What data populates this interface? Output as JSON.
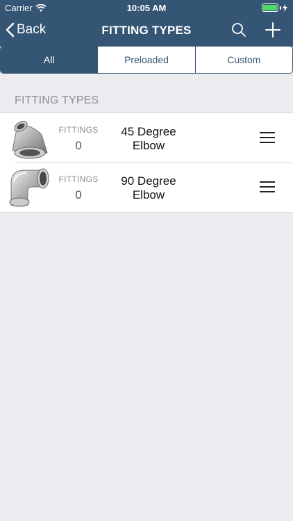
{
  "status_bar": {
    "carrier": "Carrier",
    "time": "10:05 AM",
    "battery_color": "#4cd964"
  },
  "nav": {
    "back_label": "Back",
    "title": "FITTING TYPES",
    "search_icon": "search-icon",
    "add_icon": "plus-icon",
    "bar_color": "#345574"
  },
  "segments": [
    {
      "label": "All",
      "active": true
    },
    {
      "label": "Preloaded",
      "active": false
    },
    {
      "label": "Custom",
      "active": false
    }
  ],
  "section_header": "FITTING TYPES",
  "fitting_types": [
    {
      "name_line1": "45 Degree",
      "name_line2": "Elbow",
      "count_label": "FITTINGS",
      "count": "0",
      "image_icon": "elbow-45-icon"
    },
    {
      "name_line1": "90 Degree",
      "name_line2": "Elbow",
      "count_label": "FITTINGS",
      "count": "0",
      "image_icon": "elbow-90-icon"
    }
  ]
}
